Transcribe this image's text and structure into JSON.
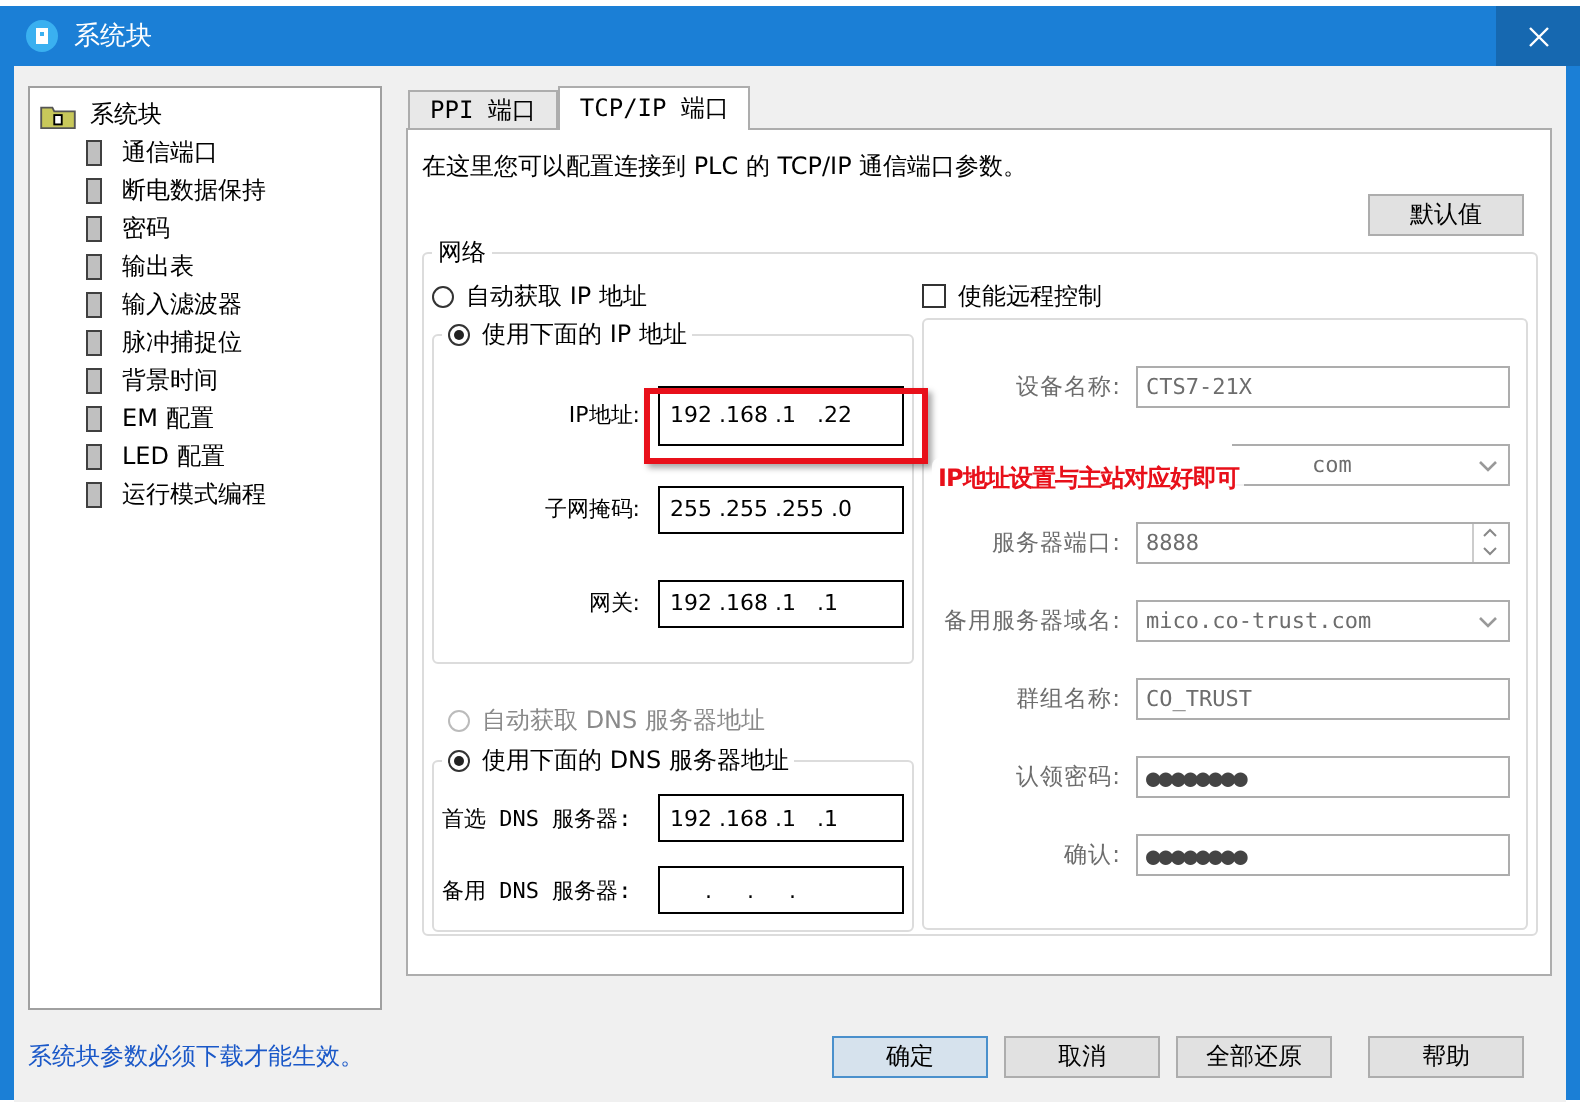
{
  "window": {
    "title": "系统块"
  },
  "tree": {
    "label": "系统块",
    "children": [
      {
        "label": "通信端口"
      },
      {
        "label": "断电数据保持"
      },
      {
        "label": "密码"
      },
      {
        "label": "输出表"
      },
      {
        "label": "输入滤波器"
      },
      {
        "label": "脉冲捕捉位"
      },
      {
        "label": "背景时间"
      },
      {
        "label": "EM 配置"
      },
      {
        "label": "LED 配置"
      },
      {
        "label": "运行模式编程"
      }
    ]
  },
  "tabs": [
    {
      "label": "PPI 端口",
      "selected": false
    },
    {
      "label": "TCP/IP 端口",
      "selected": true
    }
  ],
  "description": "在这里您可以配置连接到 PLC 的 TCP/IP 通信端口参数。",
  "default_button": "默认值",
  "network": {
    "title": "网络",
    "auto_ip": {
      "label": "自动获取 IP 地址",
      "selected": false,
      "disabled": false
    },
    "remote_control": {
      "label": "使能远程控制",
      "checked": false
    },
    "manual_ip": {
      "label": "使用下面的 IP 地址",
      "selected": true,
      "disabled": false,
      "fields": [
        {
          "label": "IP地址:",
          "value": "192 .168 .1   .22",
          "highlighted": true
        },
        {
          "label": "子网掩码:",
          "value": "255 .255 .255 .0",
          "highlighted": false
        },
        {
          "label": "网关:",
          "value": "192 .168 .1   .1",
          "highlighted": false
        }
      ]
    },
    "auto_dns": {
      "label": "自动获取 DNS 服务器地址",
      "selected": false,
      "disabled": true
    },
    "manual_dns": {
      "label": "使用下面的 DNS 服务器地址",
      "selected": true,
      "disabled": false,
      "fields": [
        {
          "label": "首选 DNS 服务器:",
          "value": "192 .168 .1   .1"
        },
        {
          "label": "备用 DNS 服务器:",
          "value": "     .     .     ."
        }
      ]
    },
    "remote": [
      {
        "kind": "text",
        "label": "设备名称:",
        "value": "CTS7-21X"
      },
      {
        "kind": "combo",
        "value": "com",
        "covered": true
      },
      {
        "kind": "spin",
        "label": "服务器端口:",
        "value": "8888"
      },
      {
        "kind": "combo",
        "label": "备用服务器域名:",
        "value": "mico.co-trust.com"
      },
      {
        "kind": "text",
        "label": "群组名称:",
        "value": "CO_TRUST"
      },
      {
        "kind": "password",
        "label": "认领密码:",
        "value": "●●●●●●●●"
      },
      {
        "kind": "password",
        "label": "确认:",
        "value": "●●●●●●●●"
      }
    ]
  },
  "annotation": {
    "text": "IP地址设置与主站对应好即可"
  },
  "status_text": "系统块参数必须下载才能生效。",
  "buttons": [
    {
      "label": "确定",
      "focused": true
    },
    {
      "label": "取消",
      "focused": false
    },
    {
      "label": "全部还原",
      "focused": false
    },
    {
      "label": "帮助",
      "focused": false
    }
  ]
}
